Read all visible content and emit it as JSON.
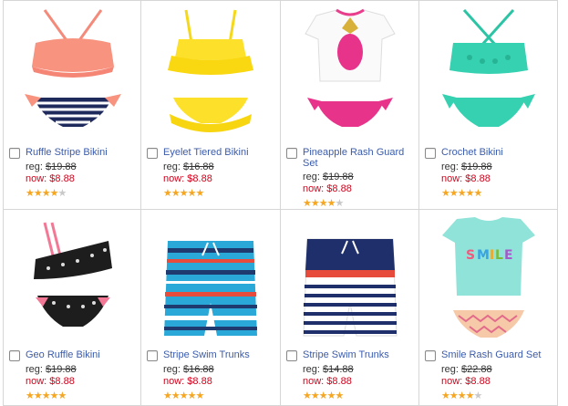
{
  "products": [
    {
      "name": "Ruffle Stripe Bikini",
      "reg_label": "reg: ",
      "reg_price": "$19.88",
      "now_label": "now: ",
      "now_price": "$8.88",
      "rating": 4,
      "icon": "ruffle-stripe-bikini-image"
    },
    {
      "name": "Eyelet Tiered Bikini",
      "reg_label": "reg: ",
      "reg_price": "$16.88",
      "now_label": "now: ",
      "now_price": "$8.88",
      "rating": 5,
      "icon": "eyelet-tiered-bikini-image"
    },
    {
      "name": "Pineapple Rash Guard Set",
      "reg_label": "reg: ",
      "reg_price": "$19.88",
      "now_label": "now: ",
      "now_price": "$8.88",
      "rating": 4,
      "icon": "pineapple-rash-guard-image"
    },
    {
      "name": "Crochet Bikini",
      "reg_label": "reg: ",
      "reg_price": "$19.88",
      "now_label": "now: ",
      "now_price": "$8.88",
      "rating": 5,
      "icon": "crochet-bikini-image"
    },
    {
      "name": "Geo Ruffle Bikini",
      "reg_label": "reg: ",
      "reg_price": "$19.88",
      "now_label": "now: ",
      "now_price": "$8.88",
      "rating": 5,
      "icon": "geo-ruffle-bikini-image"
    },
    {
      "name": "Stripe Swim Trunks",
      "reg_label": "reg: ",
      "reg_price": "$16.88",
      "now_label": "now: ",
      "now_price": "$8.88",
      "rating": 5,
      "icon": "stripe-swim-trunks-image"
    },
    {
      "name": "Stripe Swim Trunks",
      "reg_label": "reg: ",
      "reg_price": "$14.88",
      "now_label": "now: ",
      "now_price": "$8.88",
      "rating": 5,
      "icon": "navy-stripe-swim-trunks-image"
    },
    {
      "name": "Smile Rash Guard Set",
      "reg_label": "reg: ",
      "reg_price": "$22.88",
      "now_label": "now: ",
      "now_price": "$8.88",
      "rating": 4,
      "icon": "smile-rash-guard-image"
    }
  ],
  "colors": {
    "link": "#3b5bab",
    "sale": "#d0021b",
    "star": "#f5a623",
    "star_empty": "#c9c9c9"
  }
}
